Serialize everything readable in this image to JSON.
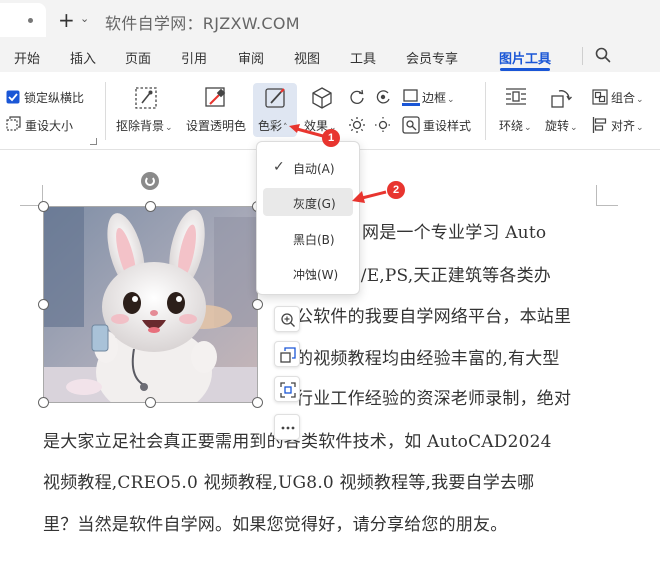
{
  "titlebar": {
    "title": "软件自学网：RJZXW.COM",
    "plus": "+",
    "caret": "⌄"
  },
  "menu": {
    "items": [
      "开始",
      "插入",
      "页面",
      "引用",
      "审阅",
      "视图",
      "工具",
      "会员专享",
      "图片工具"
    ],
    "active_index": 8
  },
  "ribbon": {
    "lock_ratio": "锁定纵横比",
    "lock_ratio_checked": true,
    "reset_size": "重设大小",
    "remove_bg": "抠除背景",
    "set_transparent": "设置透明色",
    "color": "色彩",
    "effects": "效果",
    "border": "边框",
    "reset_style": "重设样式",
    "wrap": "环绕",
    "rotate": "旋转",
    "group": "组合",
    "align": "对齐"
  },
  "dropdown": {
    "items": [
      {
        "label": "自动(A)",
        "checked": true
      },
      {
        "label": "灰度(G)",
        "checked": false
      },
      {
        "label": "黑白(B)",
        "checked": false
      },
      {
        "label": "冲蚀(W)",
        "checked": false
      }
    ]
  },
  "badges": {
    "one": "1",
    "two": "2"
  },
  "document": {
    "lines": [
      "网是一个专业学习 Auto",
      "ro/E,PS,天正建筑等各类办",
      "公软件的我要自学网络平台，本站里",
      "的视频教程均由经验丰富的,有大型",
      "行业工作经验的资深老师录制，绝对",
      "是大家立足社会真正要需用到的各类软件技术，如 AutoCAD2024",
      "视频教程,CREO5.0 视频教程,UG8.0 视频教程等,我要自学去哪",
      "里？当然是软件自学网。如果您觉得好，请分享给您的朋友。"
    ]
  },
  "colors": {
    "accent": "#1a56d6",
    "badge": "#e8352f",
    "highlight": "#dfe6f2"
  }
}
